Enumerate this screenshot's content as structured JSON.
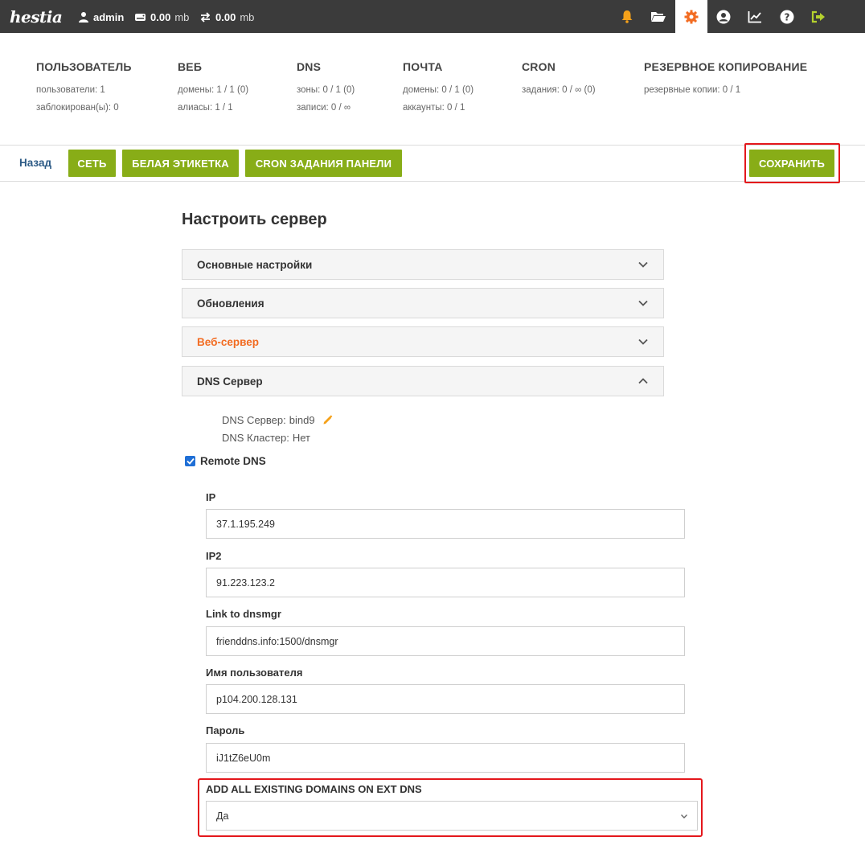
{
  "topbar": {
    "logo": "hestia",
    "user": "admin",
    "disk": {
      "value": "0.00",
      "unit": "mb"
    },
    "bandwidth": {
      "value": "0.00",
      "unit": "mb"
    },
    "colors": {
      "bg": "#3b3b3b",
      "bell": "#f5a11a",
      "gear": "#f26c22",
      "logout": "#b5d12e"
    }
  },
  "overview": {
    "user": {
      "title": "ПОЛЬЗОВАТЕЛЬ",
      "l1": "пользователи: 1",
      "l2": "заблокирован(ы): 0"
    },
    "web": {
      "title": "ВЕБ",
      "l1": "домены: 1 / 1 (0)",
      "l2": "алиасы: 1 / 1"
    },
    "dns": {
      "title": "DNS",
      "l1": "зоны: 0 / 1 (0)",
      "l2": "записи: 0 / ∞"
    },
    "mail": {
      "title": "ПОЧТА",
      "l1": "домены: 0 / 1 (0)",
      "l2": "аккаунты: 0 / 1"
    },
    "cron": {
      "title": "CRON",
      "l1": "задания: 0 / ∞ (0)"
    },
    "backup": {
      "title": "РЕЗЕРВНОЕ КОПИРОВАНИЕ",
      "l1": "резервные копии: 0 / 1"
    }
  },
  "toolbar": {
    "back": "Назад",
    "network": "СЕТЬ",
    "whitelabel": "БЕЛАЯ ЭТИКЕТКА",
    "cron_panel": "CRON ЗАДАНИЯ ПАНЕЛИ",
    "save": "СОХРАНИТЬ",
    "accent": "#88ad17"
  },
  "form": {
    "title": "Настроить сервер",
    "sections": {
      "basic": "Основные настройки",
      "updates": "Обновления",
      "webserver": "Веб-сервер",
      "dns": "DNS Сервер"
    },
    "dns_info": {
      "server_label": "DNS Сервер:",
      "server_value": "bind9",
      "cluster_label": "DNS Кластер:",
      "cluster_value": "Нет"
    },
    "remote_dns": {
      "label": "Remote DNS",
      "checked": true
    },
    "fields": {
      "ip": {
        "label": "IP",
        "value": "37.1.195.249"
      },
      "ip2": {
        "label": "IP2",
        "value": "91.223.123.2"
      },
      "link": {
        "label": "Link to dnsmgr",
        "value": "frienddns.info:1500/dnsmgr"
      },
      "username": {
        "label": "Имя пользователя",
        "value": "p104.200.128.131"
      },
      "password": {
        "label": "Пароль",
        "value": "iJ1tZ6eU0m"
      }
    },
    "add_domains": {
      "label": "ADD ALL EXISTING DOMAINS ON EXT DNS",
      "selected": "Да"
    }
  }
}
